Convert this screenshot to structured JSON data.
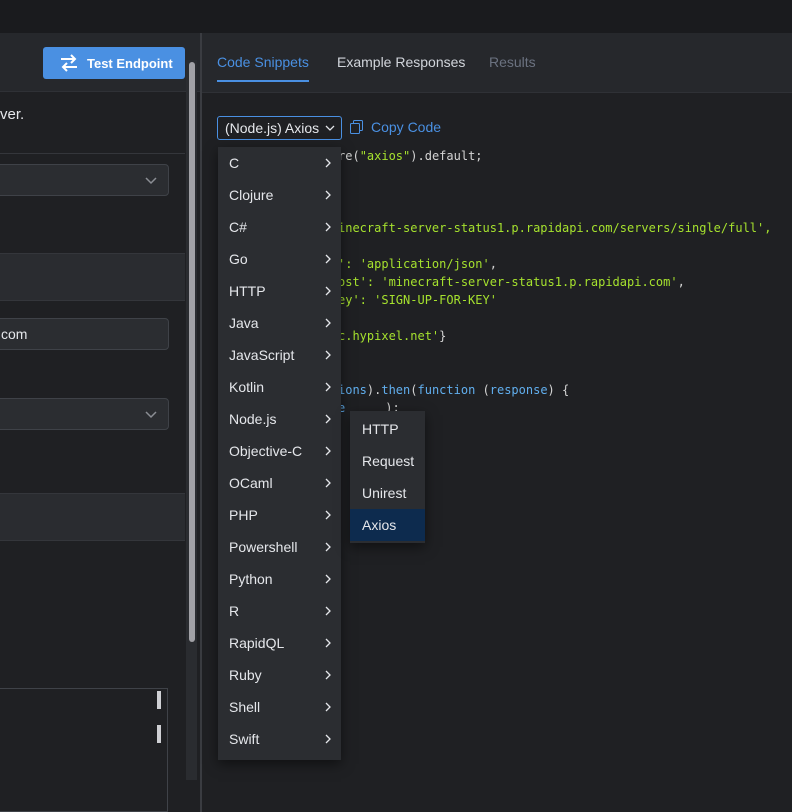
{
  "left": {
    "test_button_label": "Test Endpoint",
    "description_fragment": "ver.",
    "host_value_fragment": "com"
  },
  "tabs": [
    {
      "label": "Code Snippets",
      "state": "active"
    },
    {
      "label": "Example Responses",
      "state": "normal"
    },
    {
      "label": "Results",
      "state": "disabled"
    }
  ],
  "code_toolbar": {
    "selected_language": "(Node.js) Axios",
    "copy_label": "Copy Code"
  },
  "code_lines": {
    "l1a": "re(",
    "l1b": "\"axios\"",
    "l1c": ").default;",
    "l2": "inecraft-server-status1.p.rapidapi.com/servers/single/full',",
    "l3a": "': ",
    "l3b": "'application/json'",
    "l3c": ",",
    "l4a": "ost': ",
    "l4b": "'minecraft-server-status1.p.rapidapi.com'",
    "l4c": ",",
    "l5a": "ey': ",
    "l5b": "'SIGN-UP-FOR-KEY'",
    "l6a": "c.hypixel.net'",
    "l6b": "}",
    "l7a": "ions",
    "l7b": ").",
    "l7c": "then",
    "l7d": "(",
    "l7e": "function",
    "l7f": " (",
    "l7g": "response",
    "l7h": ") {",
    "l8a": "e",
    "l8b": ");"
  },
  "language_menu": [
    "C",
    "Clojure",
    "C#",
    "Go",
    "HTTP",
    "Java",
    "JavaScript",
    "Kotlin",
    "Node.js",
    "Objective-C",
    "OCaml",
    "PHP",
    "Powershell",
    "Python",
    "R",
    "RapidQL",
    "Ruby",
    "Shell",
    "Swift"
  ],
  "nodejs_submenu": [
    "HTTP",
    "Request",
    "Unirest",
    "Axios"
  ],
  "nodejs_selected": "Axios",
  "colors": {
    "accent": "#4a90e2",
    "background": "#1f2023",
    "menu_bg": "#2b2d31",
    "selected_bg": "#0d2b4e",
    "string_green": "#a6e22e",
    "keyword_blue": "#61afef"
  }
}
